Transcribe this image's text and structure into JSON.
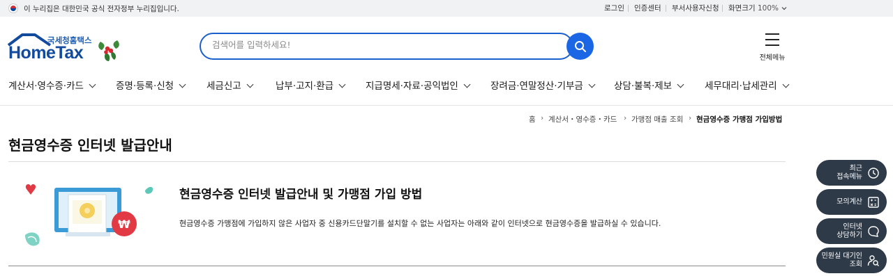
{
  "gov_banner": {
    "text": "이 누리집은 대한민국 공식 전자정부 누리집입니다."
  },
  "util_links": {
    "login": "로그인",
    "cert": "인증센터",
    "dept_apply": "부서사용자신청",
    "zoom_label": "화면크기",
    "zoom_value": "100%"
  },
  "logo": {
    "kr": "국세청홈택스",
    "en": "HomeTax"
  },
  "search": {
    "placeholder": "검색어를 입력하세요!"
  },
  "all_menu": {
    "label": "전체메뉴"
  },
  "gnb": [
    "계산서·영수증·카드",
    "증명·등록·신청",
    "세금신고",
    "납부·고지·환급",
    "지급명세·자료·공익법인",
    "장려금·연말정산·기부금",
    "상담·불복·제보",
    "세무대리·납세관리"
  ],
  "breadcrumb": [
    "홈",
    "계산서・영수증・카드",
    "가맹점 매출 조회",
    "현금영수증 가맹점 가입방법"
  ],
  "page_title": "현금영수증 인터넷 발급안내",
  "section": {
    "title": "현금영수증 인터넷 발급안내 및 가맹점 가입 방법",
    "desc": "현금영수증 가맹점에 가입하지 않은 사업자 중 신용카드단말기를 설치할 수 없는 사업자는 아래와 같이 인터넷으로 현금영수증을 발급하실 수 있습니다."
  },
  "quick_menu": [
    {
      "line1": "최근",
      "line2": "접속메뉴",
      "icon": "clock-icon"
    },
    {
      "line1": "모의계산",
      "line2": "",
      "icon": "calculator-icon"
    },
    {
      "line1": "인터넷",
      "line2": "상담하기",
      "icon": "chat-icon"
    },
    {
      "line1": "민원실 대기인",
      "line2": "조회",
      "icon": "person-search-icon"
    }
  ],
  "colors": {
    "primary": "#1b66e4",
    "brand": "#124a9e",
    "quick_bg": "#2f3a49"
  }
}
